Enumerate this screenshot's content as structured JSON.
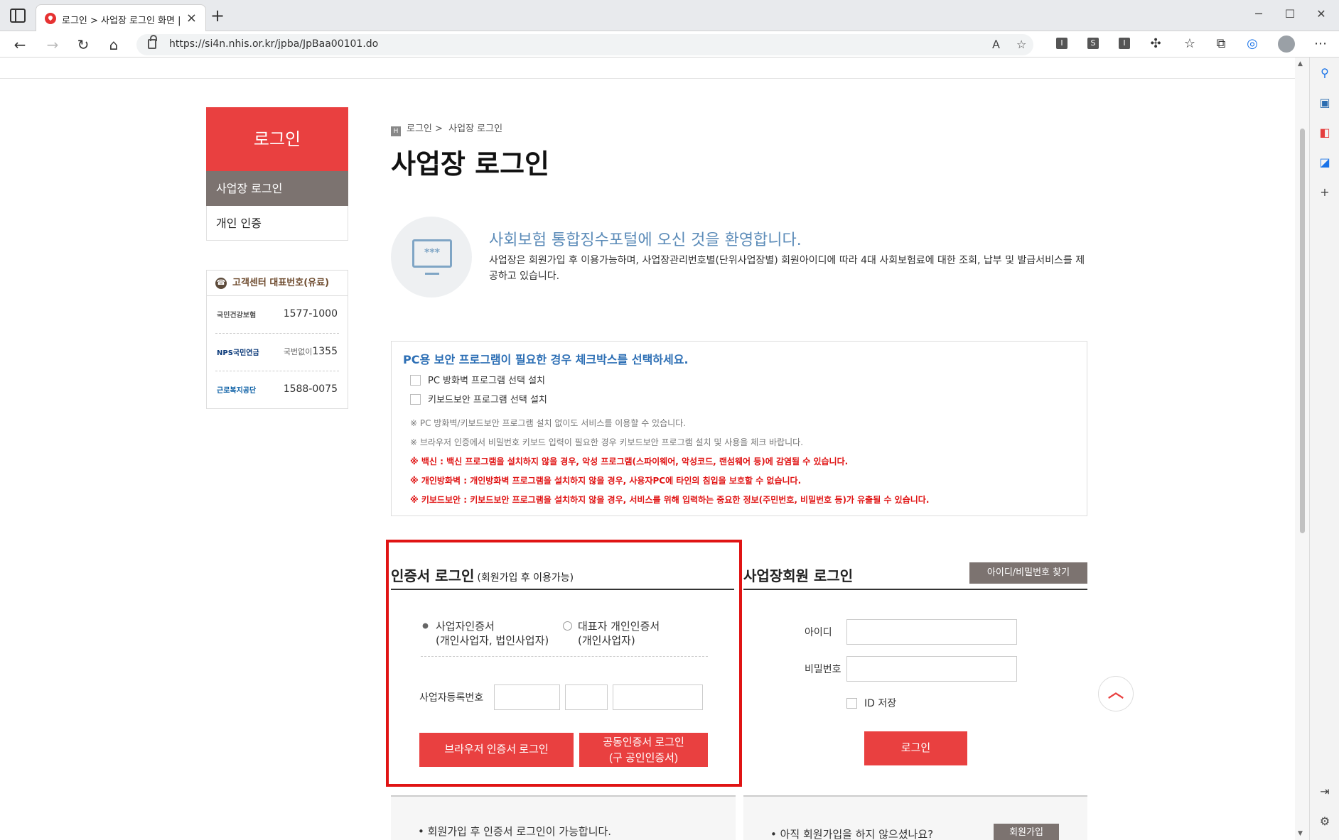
{
  "browser": {
    "tab_title": "로그인 > 사업장 로그인 화면 | h",
    "url": "https://si4n.nhis.or.kr/jpba/JpBaa00101.do"
  },
  "lnb": {
    "title": "로그인",
    "items": [
      {
        "label": "사업장 로그인",
        "active": true
      },
      {
        "label": "개인 인증",
        "active": false
      }
    ]
  },
  "customer_center": {
    "title": "고객센터 대표번호(유료)",
    "rows": [
      {
        "org": "국민건강보험",
        "prefix": "",
        "number": "1577-1000"
      },
      {
        "org": "NPS국민연금",
        "prefix": "국번없이",
        "number": "1355"
      },
      {
        "org": "근로복지공단",
        "prefix": "",
        "number": "1588-0075"
      }
    ]
  },
  "breadcrumb": {
    "first": "로그인 >",
    "second": "사업장 로그인"
  },
  "page_title": "사업장 로그인",
  "welcome": {
    "monitor_text": "***",
    "title": "사회보험 통합징수포털에 오신 것을 환영합니다.",
    "desc": "사업장은 회원가입 후 이용가능하며, 사업장관리번호별(단위사업장별) 회원아이디에 따라 4대 사회보험료에 대한 조회, 납부 및 발급서비스를 제공하고 있습니다."
  },
  "security": {
    "title": "PC용 보안 프로그램이 필요한 경우 체크박스를 선택하세요.",
    "checks": [
      "PC 방화벽 프로그램 선택 설치",
      "키보드보안 프로그램 선택 설치"
    ],
    "notes": [
      "※ PC 방화벽/키보드보안 프로그램 설치 없이도 서비스를 이용할 수 있습니다.",
      "※ 브라우저 인증에서 비밀번호 키보드 입력이 필요한 경우 키보드보안 프로그램 설치 및 사용을 체크 바랍니다."
    ],
    "warnings": [
      "※ 백신 : 백신 프로그램을 설치하지 않을 경우, 악성 프로그램(스파이웨어, 악성코드, 랜섬웨어 등)에 감염될 수 있습니다.",
      "※ 개인방화벽 : 개인방화벽 프로그램을 설치하지 않을 경우, 사용자PC에 타인의 침입을 보호할 수 없습니다.",
      "※ 키보드보안 : 키보드보안 프로그램을 설치하지 않을 경우, 서비스를 위해 입력하는 중요한 정보(주민번호, 비밀번호 등)가 유출될 수 있습니다."
    ]
  },
  "cert_login": {
    "title": "인증서 로그인",
    "subtitle": "(회원가입 후 이용가능)",
    "option1_line1": "사업자인증서",
    "option1_line2": "(개인사업자, 법인사업자)",
    "option2_line1": "대표자 개인인증서",
    "option2_line2": "(개인사업자)",
    "biz_no_label": "사업자등록번호",
    "browser_btn": "브라우저 인증서 로그인",
    "joint_btn_line1": "공동인증서 로그인",
    "joint_btn_line2": "(구 공인인증서)"
  },
  "member_login": {
    "title": "사업장회원 로그인",
    "find_btn": "아이디/비밀번호 찾기",
    "id_label": "아이디",
    "pw_label": "비밀번호",
    "id_save": "ID 저장",
    "login_btn": "로그인"
  },
  "bottom": {
    "left_text": "• 회원가입 후 인증서 로그인이 가능합니다.",
    "right_text": "• 아직 회원가입을 하지 않으셨나요?",
    "join_btn": "회원가입"
  },
  "colors": {
    "accent": "#e94040",
    "highlight": "#e01414",
    "brown": "#7c7370"
  }
}
